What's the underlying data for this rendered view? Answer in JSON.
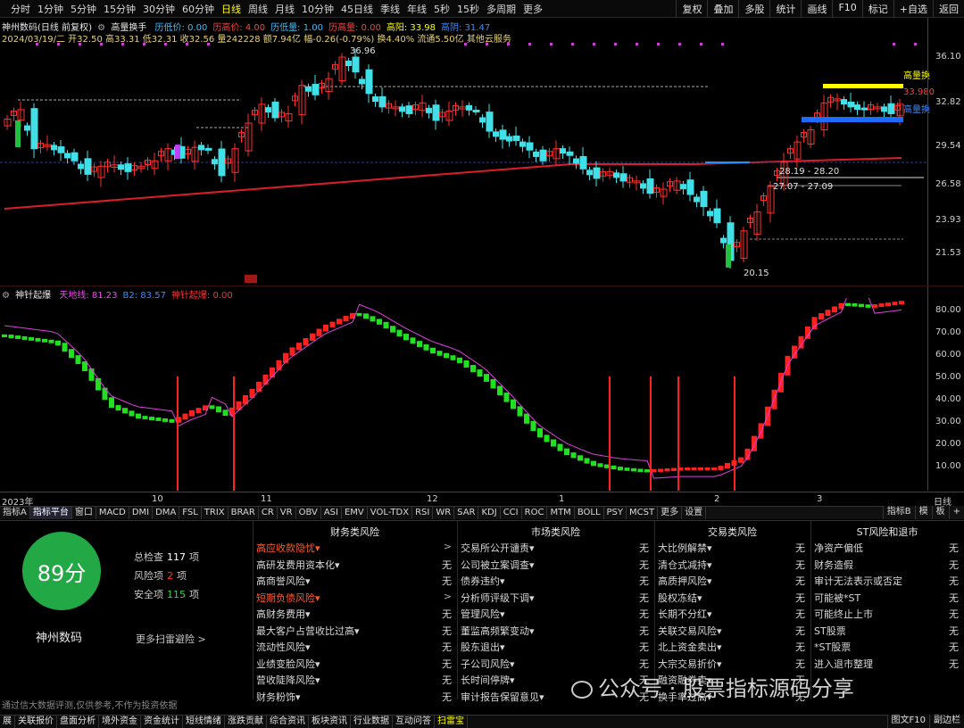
{
  "toolbar": {
    "periods": [
      "分时",
      "1分钟",
      "5分钟",
      "15分钟",
      "30分钟",
      "60分钟",
      "日线",
      "周线",
      "月线",
      "10分钟",
      "45日线",
      "季线",
      "年线",
      "5秒",
      "15秒",
      "多周期",
      "更多"
    ],
    "active_period": "日线",
    "right_buttons": [
      "复权",
      "叠加",
      "多股",
      "统计",
      "画线",
      "F10",
      "标记",
      "+自选",
      "返回"
    ]
  },
  "main_chart": {
    "title": "神州数码(日线 前复权)",
    "indicator_name": "高量换手",
    "fields": [
      {
        "label": "历低价:",
        "value": "0.00",
        "color": "#39c0ff"
      },
      {
        "label": "历高价:",
        "value": "4.00",
        "color": "#ff4040"
      },
      {
        "label": "历低量:",
        "value": "1.00",
        "color": "#39c0ff"
      },
      {
        "label": "历高量:",
        "value": "0.00",
        "color": "#ff4040"
      },
      {
        "label": "高阳:",
        "value": "33.98",
        "color": "#ffff00"
      },
      {
        "label": "高阴:",
        "value": "31.47",
        "color": "#3a8cff"
      }
    ],
    "quote_line": "2024/03/19/二 开32.50 高33.31 低32.31 收32.56 量242228 额7.94亿 幅-0.26(-0.79%) 换4.40% 流通5.50亿 其他云服务",
    "price_axis": [
      "36.10",
      "32.82",
      "29.54",
      "26.58",
      "23.93",
      "21.53"
    ],
    "annotations": {
      "high": "36.96",
      "low": "20.15",
      "zone1": "28.19 - 28.20",
      "zone2": "27.07 - 27.09",
      "right1": "高量换",
      "right2": "高量换",
      "right3": "33.980"
    },
    "date_axis": [
      "2023年",
      "10",
      "11",
      "12",
      "1",
      "2",
      "3",
      "日线"
    ],
    "lines": {
      "yellow": "#ffff00",
      "blue": "#1e6cff",
      "ma": "#d81e28"
    }
  },
  "sub_chart": {
    "name": "神针起爆",
    "fields": [
      {
        "label": "天地线:",
        "value": "81.23",
        "color": "#ff40ff"
      },
      {
        "label": "B2:",
        "value": "83.57",
        "color": "#3a8cff"
      },
      {
        "label": "神针起爆:",
        "value": "0.00",
        "color": "#ff3030"
      }
    ],
    "axis": [
      "80.00",
      "70.00",
      "60.00",
      "50.00",
      "40.00",
      "30.00",
      "20.00",
      "10.00"
    ]
  },
  "indicator_tabs": [
    "指标A",
    "指标平台",
    "窗口",
    "MACD",
    "DMI",
    "DMA",
    "FSL",
    "TRIX",
    "BRAR",
    "CR",
    "VR",
    "OBV",
    "ASI",
    "EMV",
    "VOL-TDX",
    "RSI",
    "WR",
    "SAR",
    "KDJ",
    "CCI",
    "ROC",
    "MTM",
    "BOLL",
    "PSY",
    "MCST",
    "更多",
    "设置"
  ],
  "indicator_right": [
    "指标B",
    "模",
    "板",
    "+"
  ],
  "scan": {
    "score": "89分",
    "stock": "神州数码",
    "total_label": "总检查",
    "total": "117",
    "unit": "项",
    "risk_label": "风险项",
    "risk": "2",
    "safe_label": "安全项",
    "safe": "115",
    "more": "更多扫雷避险 >",
    "disclaimer": "通过信大数据评测,仅供参考,不作为投资依据",
    "columns": [
      {
        "title": "财务类风险",
        "items": [
          {
            "k": "高应收款隐忧",
            "v": ">",
            "warn": true
          },
          {
            "k": "高研发费用资本化",
            "v": "无"
          },
          {
            "k": "高商誉风险",
            "v": "无"
          },
          {
            "k": "短期负债风险",
            "v": ">",
            "warn": true
          },
          {
            "k": "高财务费用",
            "v": "无"
          },
          {
            "k": "最大客户占营收比过高",
            "v": "无"
          },
          {
            "k": "流动性风险",
            "v": "无"
          },
          {
            "k": "业绩变脸风险",
            "v": "无"
          },
          {
            "k": "营收陡降风险",
            "v": "无"
          },
          {
            "k": "财务粉饰",
            "v": "无"
          }
        ]
      },
      {
        "title": "市场类风险",
        "items": [
          {
            "k": "交易所公开谴责",
            "v": "无"
          },
          {
            "k": "公司被立案调查",
            "v": "无"
          },
          {
            "k": "债券违约",
            "v": "无"
          },
          {
            "k": "分析师评级下调",
            "v": "无"
          },
          {
            "k": "管理风险",
            "v": "无"
          },
          {
            "k": "董监高频繁变动",
            "v": "无"
          },
          {
            "k": "股东退出",
            "v": "无"
          },
          {
            "k": "子公司风险",
            "v": "无"
          },
          {
            "k": "长时间停牌",
            "v": "无"
          },
          {
            "k": "审计报告保留意见",
            "v": "无"
          }
        ]
      },
      {
        "title": "交易类风险",
        "items": [
          {
            "k": "大比例解禁",
            "v": "无"
          },
          {
            "k": "清仓式减持",
            "v": "无"
          },
          {
            "k": "高质押风险",
            "v": "无"
          },
          {
            "k": "股权冻结",
            "v": "无"
          },
          {
            "k": "长期不分红",
            "v": "无"
          },
          {
            "k": "关联交易风险",
            "v": "无"
          },
          {
            "k": "北上资金卖出",
            "v": "无"
          },
          {
            "k": "大宗交易折价",
            "v": "无"
          },
          {
            "k": "融资融券卖",
            "v": "无"
          },
          {
            "k": "换手率过高",
            "v": "无"
          }
        ]
      },
      {
        "title": "ST风险和退市",
        "items": [
          {
            "k": "净资产偏低",
            "v": "无"
          },
          {
            "k": "财务造假",
            "v": "无"
          },
          {
            "k": "审计无法表示或否定",
            "v": "无"
          },
          {
            "k": "可能被*ST",
            "v": "无"
          },
          {
            "k": "可能终止上市",
            "v": "无"
          },
          {
            "k": "ST股票",
            "v": "无"
          },
          {
            "k": "*ST股票",
            "v": "无"
          },
          {
            "k": "进入退市整理",
            "v": "无"
          }
        ]
      }
    ]
  },
  "bottom_tabs": [
    "展",
    "关联报价",
    "盘面分析",
    "境外资金",
    "资金统计",
    "短线情绪",
    "涨跌贡献",
    "综合资讯",
    "板块资讯",
    "行业数据",
    "互动问答",
    "扫雷宝"
  ],
  "bottom_active": "扫雷宝",
  "bottom_right": [
    "图文F10",
    "副边栏"
  ],
  "watermark": "公众号 · 股票指标源码分享"
}
